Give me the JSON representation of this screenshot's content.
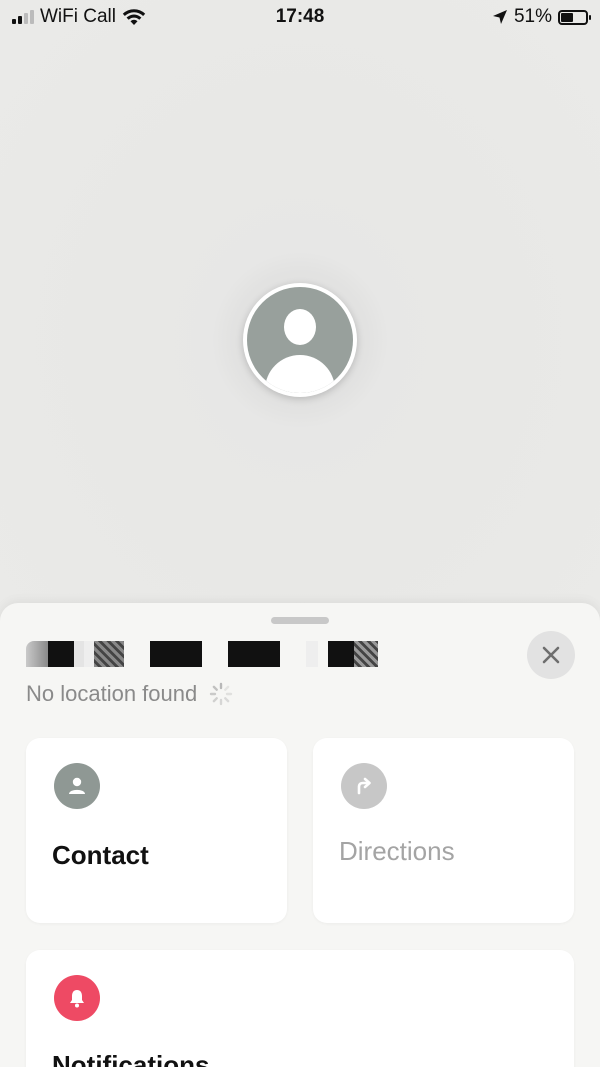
{
  "status_bar": {
    "carrier": "WiFi Call",
    "time": "17:48",
    "battery_percent": "51%",
    "battery_level": 0.51,
    "signal_bars_active": 2,
    "icons": [
      "signal-icon",
      "wifi-icon",
      "location-arrow-icon",
      "battery-icon"
    ]
  },
  "map": {
    "avatar_icon": "person-avatar-icon"
  },
  "sheet": {
    "status_text": "No location found",
    "close_icon": "close-icon",
    "cards": {
      "contact": {
        "label": "Contact",
        "icon": "person-icon",
        "icon_color": "#8f9894"
      },
      "directions": {
        "label": "Directions",
        "icon": "directions-arrow-icon",
        "icon_color": "#c7c7c7",
        "disabled": true
      },
      "notifications": {
        "label": "Notifications",
        "icon": "bell-icon",
        "icon_color": "#ee4a64"
      }
    }
  },
  "colors": {
    "map_background": "#e9e9e7",
    "sheet_background": "#f6f6f4",
    "notification_accent": "#ee4a64"
  }
}
